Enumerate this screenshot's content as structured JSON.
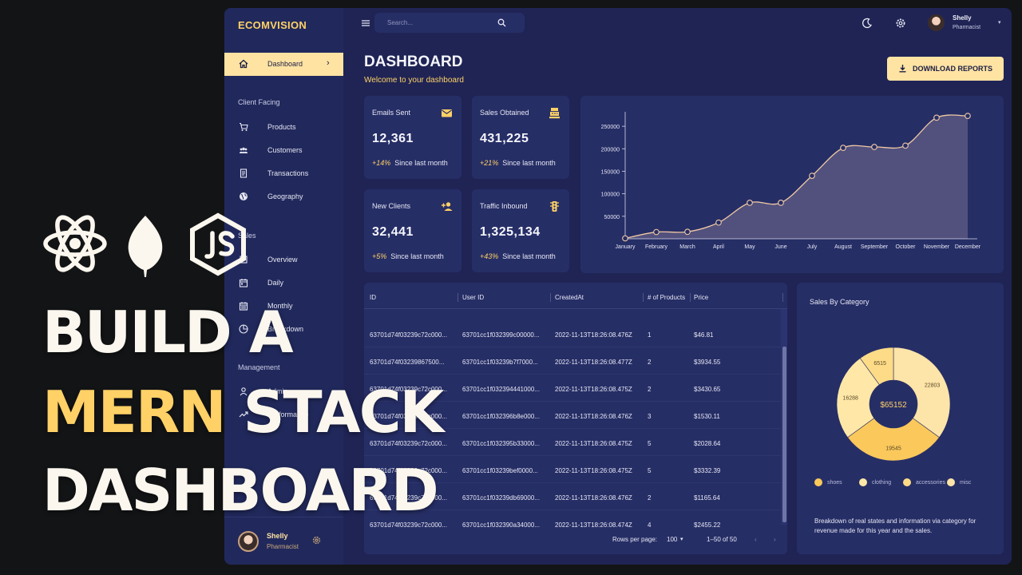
{
  "app": {
    "brand": "ECOMVISION"
  },
  "sidebar": {
    "active": {
      "label": "Dashboard",
      "chevron": "›"
    },
    "sections": [
      {
        "title": "Client Facing",
        "items": [
          {
            "label": "Products",
            "icon": "cart-icon"
          },
          {
            "label": "Customers",
            "icon": "groups-icon"
          },
          {
            "label": "Transactions",
            "icon": "receipt-icon"
          },
          {
            "label": "Geography",
            "icon": "globe-icon"
          }
        ]
      },
      {
        "title": "Sales",
        "items": [
          {
            "label": "Overview",
            "icon": "point-of-sale-icon"
          },
          {
            "label": "Daily",
            "icon": "calendar-today-icon"
          },
          {
            "label": "Monthly",
            "icon": "calendar-month-icon"
          },
          {
            "label": "Breakdown",
            "icon": "pie-chart-icon"
          }
        ]
      },
      {
        "title": "Management",
        "items": [
          {
            "label": "Admin",
            "icon": "admin-icon"
          },
          {
            "label": "Performance",
            "icon": "trending-up-icon"
          }
        ]
      }
    ],
    "user": {
      "name": "Shelly",
      "role": "Pharmacist"
    }
  },
  "topbar": {
    "search_placeholder": "Search...",
    "user": {
      "name": "Shelly",
      "role": "Pharmacist",
      "caret": "▾"
    }
  },
  "header": {
    "title": "DASHBOARD",
    "subtitle": "Welcome to your dashboard",
    "download_label": "DOWNLOAD REPORTS"
  },
  "stats": [
    {
      "title": "Emails Sent",
      "value": "12,361",
      "increase": "+14%",
      "desc": "Since last month",
      "icon": "email-icon"
    },
    {
      "title": "Sales Obtained",
      "value": "431,225",
      "increase": "+21%",
      "desc": "Since last month",
      "icon": "point-of-sale-icon"
    },
    {
      "title": "New Clients",
      "value": "32,441",
      "increase": "+5%",
      "desc": "Since last month",
      "icon": "person-add-icon"
    },
    {
      "title": "Traffic Inbound",
      "value": "1,325,134",
      "increase": "+43%",
      "desc": "Since last month",
      "icon": "traffic-icon"
    }
  ],
  "chart_data": [
    {
      "type": "area",
      "categories": [
        "January",
        "February",
        "March",
        "April",
        "May",
        "June",
        "July",
        "August",
        "September",
        "October",
        "November",
        "December"
      ],
      "values": [
        1000,
        15000,
        15500,
        36000,
        80000,
        80000,
        140000,
        202000,
        204000,
        207000,
        269000,
        273000
      ],
      "ylim": [
        0,
        275000
      ],
      "yticks": [
        "50000",
        "100000",
        "150000",
        "200000",
        "250000"
      ],
      "xlabel": "",
      "ylabel": "",
      "grid": false
    },
    {
      "type": "pie",
      "title": "Sales By Category",
      "center_label": "$65152",
      "slices": [
        {
          "name": "shoes",
          "value": 19545
        },
        {
          "name": "clothing",
          "value": 16288
        },
        {
          "name": "accessories",
          "value": 6515
        },
        {
          "name": "misc",
          "value": 22803
        }
      ],
      "colors": [
        "#fbc85b",
        "#ffe8a7",
        "#fddb87",
        "#fde4a8"
      ],
      "description": "Breakdown of real states and information via category for revenue made for this year and the sales."
    }
  ],
  "table": {
    "columns": [
      "ID",
      "User ID",
      "CreatedAt",
      "# of Products",
      "Price"
    ],
    "rows": [
      [
        "63701d74f03239c72c000...",
        "63701cc1f032399c00000...",
        "2022-11-13T18:26:08.476Z",
        "1",
        "$46.81"
      ],
      [
        "63701d74f03239867500...",
        "63701cc1f03239b7f7000...",
        "2022-11-13T18:26:08.477Z",
        "2",
        "$3934.55"
      ],
      [
        "63701d74f03239c72c000...",
        "63701cc1f032394441000...",
        "2022-11-13T18:26:08.475Z",
        "2",
        "$3430.65"
      ],
      [
        "63701d74f03239c72c000...",
        "63701cc1f032396b8e000...",
        "2022-11-13T18:26:08.476Z",
        "3",
        "$1530.11"
      ],
      [
        "63701d74f03239c72c000...",
        "63701cc1f032395b33000...",
        "2022-11-13T18:26:08.475Z",
        "5",
        "$2028.64"
      ],
      [
        "63701d74f03239c72c000...",
        "63701cc1f03239bef0000...",
        "2022-11-13T18:26:08.475Z",
        "5",
        "$3332.39"
      ],
      [
        "63701d74f03239c72c000...",
        "63701cc1f03239db69000...",
        "2022-11-13T18:26:08.476Z",
        "2",
        "$1165.64"
      ],
      [
        "63701d74f03239c72c000...",
        "63701cc1f032390a34000...",
        "2022-11-13T18:26:08.474Z",
        "4",
        "$2455.22"
      ]
    ],
    "footer": {
      "rows_per_page_label": "Rows per page:",
      "rows_per_page": "100",
      "range": "1–50 of 50"
    }
  },
  "overlay": {
    "line1": "BUILD A",
    "line2_accent": "MERN",
    "line2_rest": " STACK",
    "line3": "DASHBOARD",
    "logos": [
      "react-icon",
      "mongodb-leaf-icon",
      "nodejs-icon"
    ]
  },
  "colors": {
    "accent": "#ffd166",
    "accent_light": "#ffe3a3",
    "panel": "#262e66",
    "background": "#1f2455"
  }
}
